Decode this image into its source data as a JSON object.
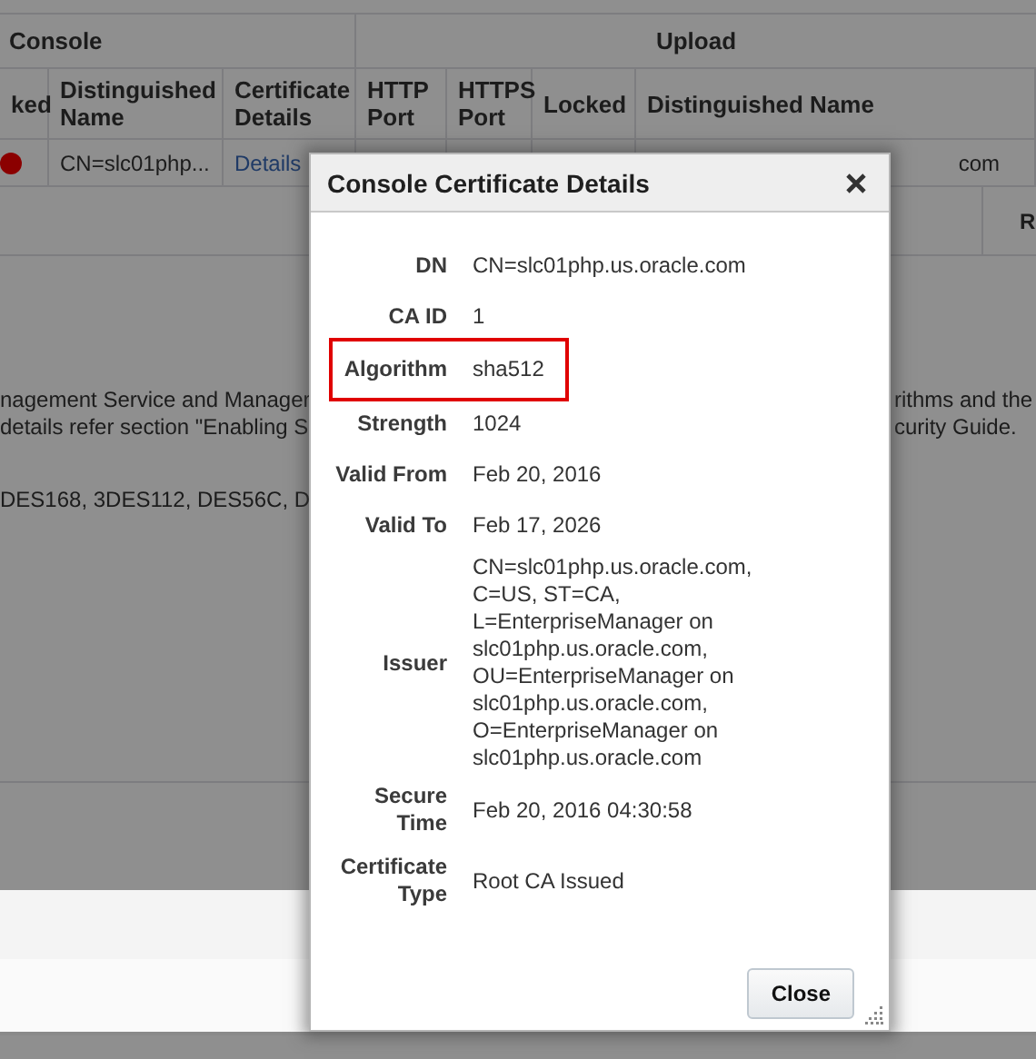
{
  "background": {
    "group_headers": [
      "Console",
      "Upload"
    ],
    "columns": [
      "ked",
      "Distinguished Name",
      "Certificate Details",
      "HTTP Port",
      "HTTPS Port",
      "Locked",
      "Distinguished Name"
    ],
    "row": {
      "distinguished_name": "CN=slc01php...",
      "certificate_details": "Details",
      "upload_distinguished_name": "com"
    },
    "row_2": {
      "column_7": "R"
    },
    "note_left": [
      "nagement Service and Manager",
      "details refer section \"Enabling S"
    ],
    "note_right": [
      "rithms and the",
      "curity Guide."
    ],
    "ciphers": "DES168, 3DES112, DES56C, D"
  },
  "dialog": {
    "title": "Console Certificate Details",
    "fields": [
      {
        "label": "DN",
        "value": "CN=slc01php.us.oracle.com",
        "highlighted": false
      },
      {
        "label": "CA ID",
        "value": "1",
        "highlighted": false
      },
      {
        "label": "Algorithm",
        "value": "sha512",
        "highlighted": true
      },
      {
        "label": "Strength",
        "value": "1024",
        "highlighted": false
      },
      {
        "label": "Valid From",
        "value": "Feb 20, 2016",
        "highlighted": false
      },
      {
        "label": "Valid To",
        "value": "Feb 17, 2026",
        "highlighted": false
      },
      {
        "label": "Issuer",
        "value": "CN=slc01php.us.oracle.com,\nC=US, ST=CA,\nL=EnterpriseManager on\nslc01php.us.oracle.com,\nOU=EnterpriseManager on\nslc01php.us.oracle.com,\nO=EnterpriseManager on\nslc01php.us.oracle.com",
        "highlighted": false
      },
      {
        "label": "Secure\nTime",
        "value": "Feb 20, 2016 04:30:58",
        "highlighted": false
      },
      {
        "label": "Certificate\nType",
        "value": "Root CA Issued",
        "highlighted": false
      }
    ],
    "button": "Close"
  }
}
